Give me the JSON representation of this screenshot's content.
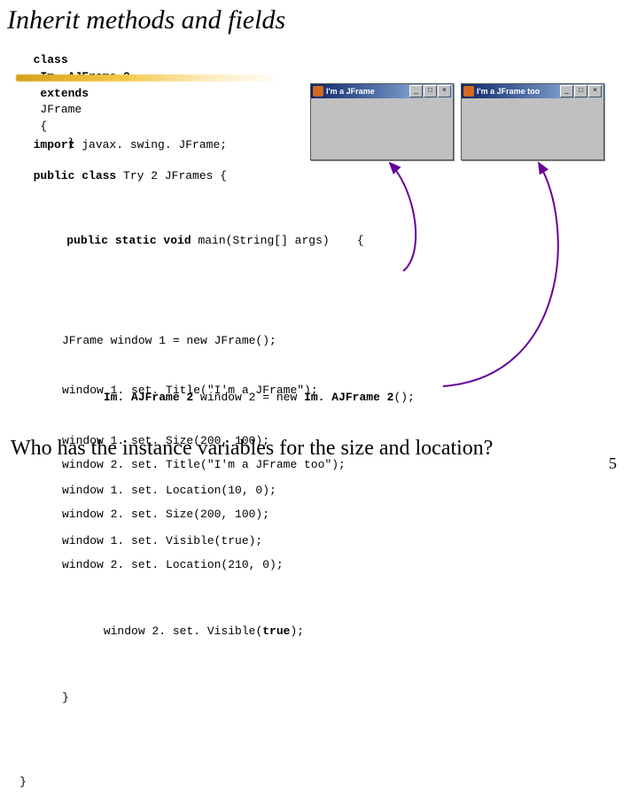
{
  "title": "Inherit methods and fields",
  "decl": {
    "class_kw": "class",
    "name": "Im. AJFrame 2",
    "extends_kw": "extends",
    "parent": "JFrame",
    "open": "{",
    "close": "}"
  },
  "import_line": {
    "kw": "import",
    "rest": " javax. swing. JFrame;"
  },
  "class_line": {
    "kw": "public class",
    "rest": " Try 2 JFrames {"
  },
  "main_sig": {
    "kw": "public static void",
    "rest": " main(String[] args)",
    "brace": "{"
  },
  "block1": {
    "l1": "JFrame window 1 = new JFrame();",
    "l2": "window 1. set. Title(\"I'm a JFrame\");",
    "l3": "window 1. set. Size(200, 100);",
    "l4": "window 1. set. Location(10, 0);",
    "l5": "window 1. set. Visible(true);"
  },
  "block2": {
    "l1a": "Im. AJFrame 2",
    "l1b": " window 2 = new ",
    "l1c": "Im. AJFrame 2",
    "l1d": "();",
    "l2": "window 2. set. Title(\"I'm a JFrame too\");",
    "l3": "window 2. set. Size(200, 100);",
    "l4": "window 2. set. Location(210, 0);",
    "l5a": "window 2. set. Visible(",
    "l5b": "true",
    "l5c": ");",
    "l6": "}",
    "l7": "}"
  },
  "windows": {
    "w1_title": "I'm a JFrame",
    "w2_title": "I'm a JFrame too"
  },
  "footer_question": "Who has the instance variables for the size and location?",
  "page_number": "5"
}
